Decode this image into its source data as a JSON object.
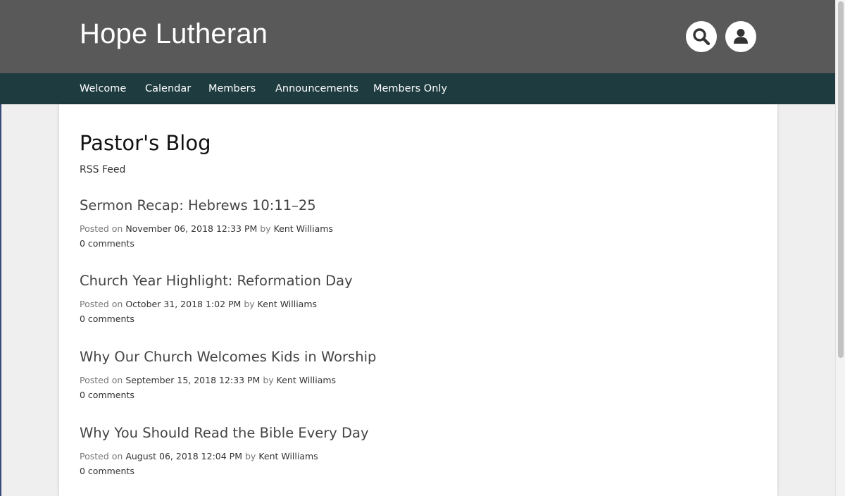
{
  "header": {
    "site_title": "Hope Lutheran",
    "background_color": "#595959",
    "search_icon": "search-icon",
    "user_icon": "user-icon"
  },
  "nav": {
    "background_color": "#1e3b40",
    "items": [
      {
        "label": "Welcome"
      },
      {
        "label": "Calendar"
      },
      {
        "label": "Members"
      },
      {
        "label": "Announcements"
      },
      {
        "label": "Members Only"
      }
    ]
  },
  "main": {
    "page_title": "Pastor's Blog",
    "rss_label": "RSS Feed",
    "posts": [
      {
        "title": "Sermon Recap: Hebrews 10:11–25",
        "posted_on_label": "Posted on",
        "date": "November 06, 2018 12:33 PM",
        "by_label": "by",
        "author": "Kent Williams",
        "comments": "0 comments"
      },
      {
        "title": "Church Year Highlight: Reformation Day",
        "posted_on_label": "Posted on",
        "date": "October 31, 2018 1:02 PM",
        "by_label": "by",
        "author": "Kent Williams",
        "comments": "0 comments"
      },
      {
        "title": "Why Our Church Welcomes Kids in Worship",
        "posted_on_label": "Posted on",
        "date": "September 15, 2018 12:33 PM",
        "by_label": "by",
        "author": "Kent Williams",
        "comments": "0 comments"
      },
      {
        "title": "Why You Should Read the Bible Every Day",
        "posted_on_label": "Posted on",
        "date": "August 06, 2018 12:04 PM",
        "by_label": "by",
        "author": "Kent Williams",
        "comments": "0 comments"
      }
    ]
  }
}
